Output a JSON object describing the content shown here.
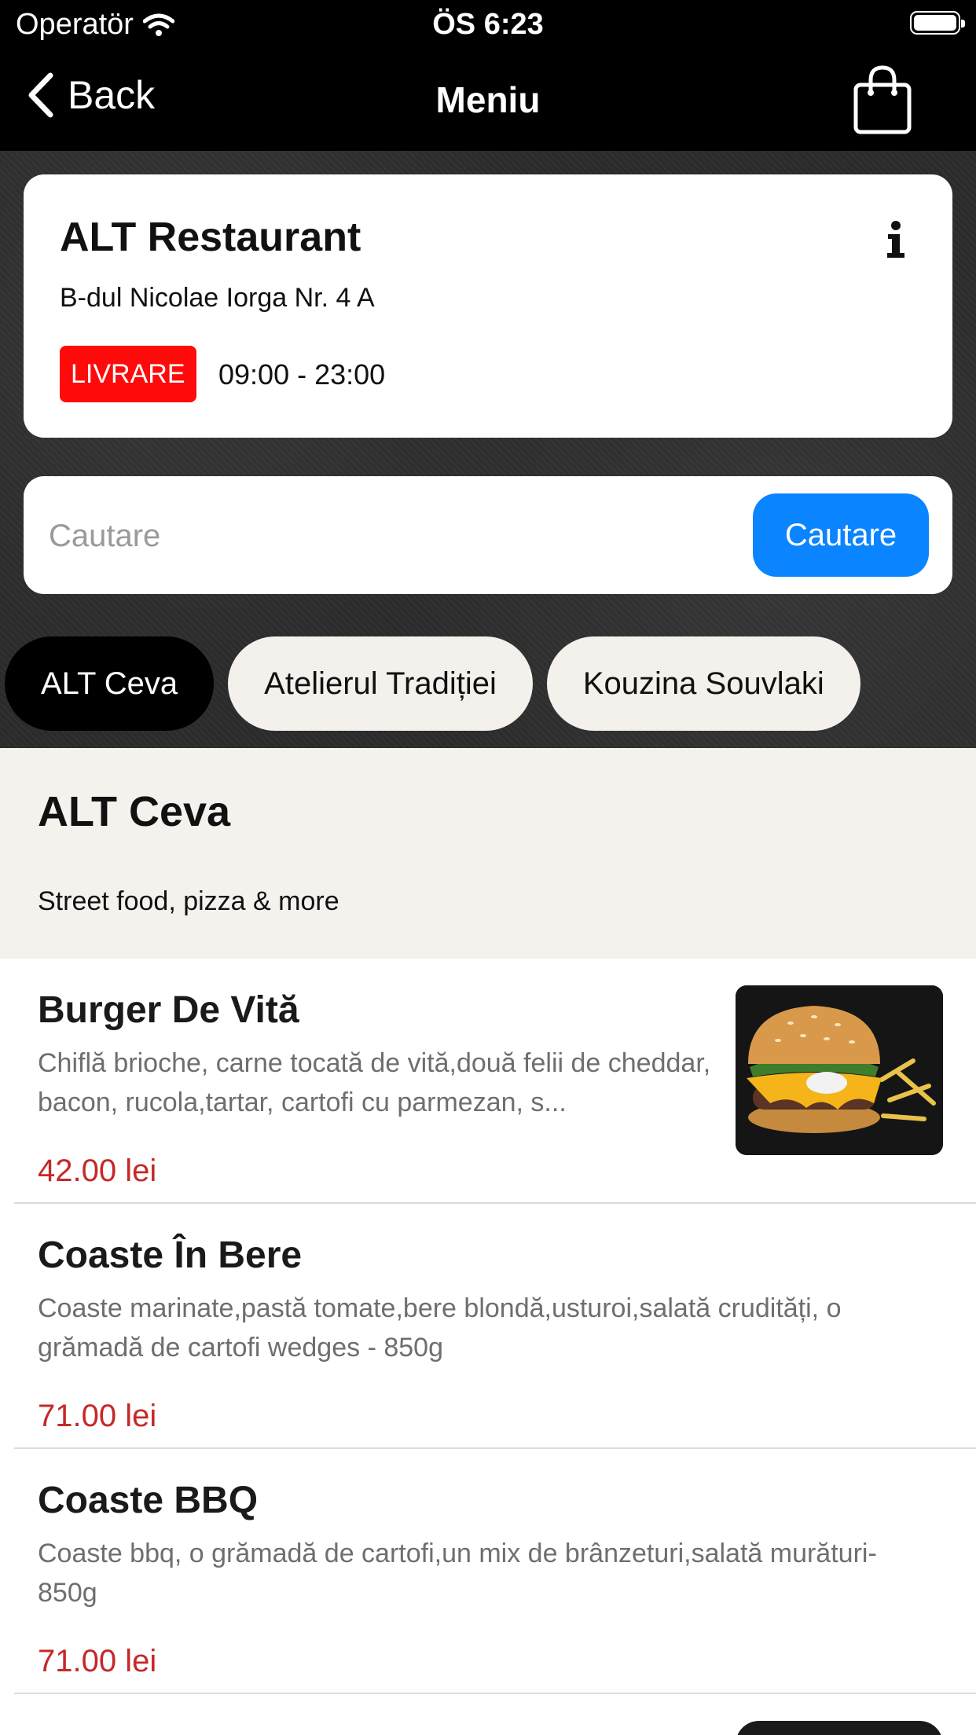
{
  "status_bar": {
    "carrier": "Operatör",
    "time": "ÖS 6:23"
  },
  "nav": {
    "back_label": "Back",
    "title": "Meniu"
  },
  "restaurant": {
    "name": "ALT Restaurant",
    "address": "B-dul Nicolae Iorga Nr. 4 A",
    "delivery_badge": "LIVRARE",
    "hours": "09:00 - 23:00"
  },
  "search": {
    "placeholder": "Cautare",
    "button_label": "Cautare"
  },
  "categories": [
    {
      "label": "ALT Ceva",
      "active": true
    },
    {
      "label": "Atelierul Tradiției",
      "active": false
    },
    {
      "label": "Kouzina Souvlaki",
      "active": false
    }
  ],
  "section": {
    "title": "ALT Ceva",
    "subtitle": "Street food, pizza & more"
  },
  "menu_items": [
    {
      "name": "Burger De Vită",
      "description": "Chiflă brioche, carne tocată de vită,două felii de cheddar, bacon, rucola,tartar, cartofi cu parmezan, s...",
      "price": "42.00 lei",
      "image": "burger-photo"
    },
    {
      "name": "Coaste În Bere",
      "description": "Coaste marinate,pastă tomate,bere blondă,usturoi,salată crudități, o grămadă de cartofi wedges - 850g",
      "price": "71.00 lei",
      "image": ""
    },
    {
      "name": "Coaste BBQ",
      "description": "Coaste bbq, o grămadă de cartofi,un mix de brânzeturi,salată murături- 850g",
      "price": "71.00 lei",
      "image": ""
    }
  ],
  "colors": {
    "accent_blue": "#0a84ff",
    "badge_red": "#ff0a0a",
    "price_red": "#c62828",
    "nav_black": "#000000"
  },
  "icons": [
    "wifi-icon",
    "battery-icon",
    "chevron-left-icon",
    "shopping-bag-icon",
    "info-icon"
  ]
}
